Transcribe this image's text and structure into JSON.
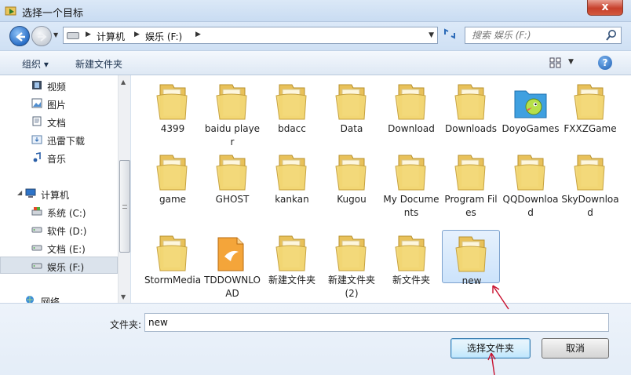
{
  "window": {
    "title": "选择一个目标",
    "close_glyph": "x"
  },
  "address": {
    "crumbs": [
      "计算机",
      "娱乐 (F:)"
    ],
    "search_placeholder": "搜索 娱乐 (F:)"
  },
  "toolbar": {
    "organize": "组织 ▾",
    "new_folder": "新建文件夹",
    "help_glyph": "?"
  },
  "nav": [
    {
      "label": "视频",
      "icon": "video-icon"
    },
    {
      "label": "图片",
      "icon": "picture-icon"
    },
    {
      "label": "文档",
      "icon": "document-icon"
    },
    {
      "label": "迅雷下载",
      "icon": "download-folder-icon"
    },
    {
      "label": "音乐",
      "icon": "music-icon"
    },
    {
      "label": "计算机",
      "icon": "computer-icon"
    },
    {
      "label": "系统 (C:)",
      "icon": "system-drive-icon"
    },
    {
      "label": "软件 (D:)",
      "icon": "drive-icon"
    },
    {
      "label": "文档 (E:)",
      "icon": "drive-icon"
    },
    {
      "label": "娱乐 (F:)",
      "icon": "drive-icon"
    },
    {
      "label": "网络",
      "icon": "network-icon"
    }
  ],
  "files": [
    {
      "name": "4399",
      "icon": "folder-icon"
    },
    {
      "name": "baidu player",
      "icon": "folder-icon"
    },
    {
      "name": "bdacc",
      "icon": "folder-icon"
    },
    {
      "name": "Data",
      "icon": "folder-icon"
    },
    {
      "name": "Download",
      "icon": "folder-icon"
    },
    {
      "name": "Downloads",
      "icon": "folder-icon"
    },
    {
      "name": "DoyoGames",
      "icon": "doyogames-folder-icon"
    },
    {
      "name": "FXXZGame",
      "icon": "folder-icon"
    },
    {
      "name": "game",
      "icon": "folder-icon"
    },
    {
      "name": "GHOST",
      "icon": "folder-icon"
    },
    {
      "name": "kankan",
      "icon": "folder-icon"
    },
    {
      "name": "Kugou",
      "icon": "folder-icon"
    },
    {
      "name": "My Documents",
      "icon": "folder-icon"
    },
    {
      "name": "Program Files",
      "icon": "folder-icon"
    },
    {
      "name": "QQDownload",
      "icon": "folder-icon"
    },
    {
      "name": "SkyDownload",
      "icon": "folder-icon"
    },
    {
      "name": "StormMedia",
      "icon": "folder-icon"
    },
    {
      "name": "TDDOWNLOAD",
      "icon": "tddownload-folder-icon"
    },
    {
      "name": "新建文件夹",
      "icon": "folder-icon"
    },
    {
      "name": "新建文件夹 (2)",
      "icon": "folder-icon"
    },
    {
      "name": "新文件夹",
      "icon": "folder-icon"
    },
    {
      "name": "new",
      "icon": "folder-icon"
    }
  ],
  "bottom": {
    "folder_label": "文件夹:",
    "folder_value": "new",
    "select_button": "选择文件夹",
    "cancel_button": "取消"
  },
  "colors": {
    "accent": "#3c7fb1",
    "annotation": "#c8102e",
    "folder": "#f1d36c"
  }
}
